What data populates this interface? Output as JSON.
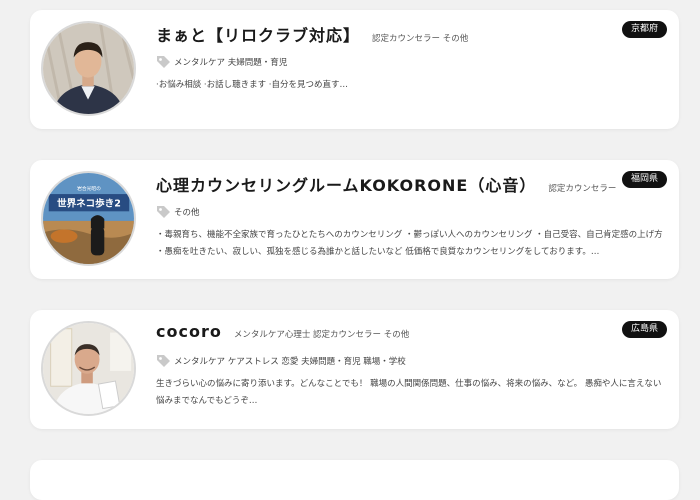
{
  "counselors": [
    {
      "name": "まぁと【リロクラブ対応】",
      "role": "認定カウンセラー その他",
      "prefecture": "京都府",
      "tags": "メンタルケア 夫婦問題・育児",
      "description": "·お悩み相談 ·お話し聴きます ·自分を見つめ直す…"
    },
    {
      "name": "心理カウンセリングルームKOKORONE（心音）",
      "role": "認定カウンセラー",
      "prefecture": "福岡県",
      "tags": "その他",
      "description": "・毒親育ち、機能不全家族で育ったひとたちへのカウンセリング ・鬱っぽい人へのカウンセリング ・自己受容、自己肯定感の上げ方 ・愚痴を吐きたい、寂しい、孤独を感じる為誰かと話したいなど 低価格で良質なカウンセリングをしております。…",
      "thumb_text": [
        "世界ネコ歩き2",
        "岩合光昭の"
      ]
    },
    {
      "name": "cocoro",
      "role": "メンタルケア心理士 認定カウンセラー その他",
      "prefecture": "広島県",
      "tags": "メンタルケア ケアストレス 恋愛 夫婦問題・育児 職場・学校",
      "description": "生きづらい心の悩みに寄り添います。どんなことでも！ 職場の人間関係問題、仕事の悩み、将来の悩み、など。 愚痴や人に言えない悩みまでなんでもどうぞ…"
    }
  ]
}
